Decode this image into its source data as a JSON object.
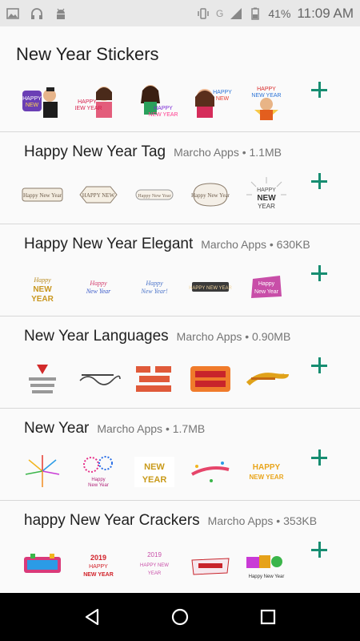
{
  "status_bar": {
    "icons": [
      "image-icon",
      "headphones-icon",
      "android-icon"
    ],
    "right_icons": [
      "vibrate-icon",
      "signal-icon",
      "battery-icon"
    ],
    "network": "G",
    "battery_percent": "41%",
    "time": "11:09 AM"
  },
  "page": {
    "title": "New Year Stickers"
  },
  "colors": {
    "accent": "#168d71",
    "divider": "#d8d8d8",
    "meta": "#757575"
  },
  "packs": [
    {
      "name": "",
      "meta": "",
      "stickers": [
        "couple-man-sticker",
        "woman-new-year-sticker",
        "woman-new-year-sticker-2",
        "woman-new-year-sticker-3",
        "man-happy-new-year-sticker"
      ]
    },
    {
      "name": "Happy New Year Tag",
      "meta": "Marcho Apps • 1.1MB",
      "stickers": [
        "tag-sticker-1",
        "tag-sticker-2",
        "tag-sticker-3",
        "tag-sticker-4",
        "new-year-burst-sticker"
      ]
    },
    {
      "name": "Happy New Year Elegant",
      "meta": "Marcho Apps • 630KB",
      "stickers": [
        "elegant-sticker-1",
        "elegant-sticker-2",
        "elegant-sticker-3",
        "elegant-sticker-4",
        "elegant-sticker-5"
      ]
    },
    {
      "name": "New Year Languages",
      "meta": "Marcho Apps • 0.90MB",
      "stickers": [
        "language-sticker-1",
        "language-sticker-2",
        "language-sticker-3",
        "language-sticker-4",
        "language-sticker-5"
      ]
    },
    {
      "name": "New Year",
      "meta": "Marcho Apps • 1.7MB",
      "stickers": [
        "fireworks-sticker-1",
        "fireworks-sticker-2",
        "gold-new-year-sticker",
        "confetti-sticker",
        "happy-new-year-sticker"
      ]
    },
    {
      "name": "happy New Year Crackers",
      "meta": "Marcho Apps • 353KB",
      "stickers": [
        "crackers-sticker-1",
        "crackers-sticker-2",
        "crackers-sticker-3",
        "crackers-sticker-4",
        "crackers-sticker-5"
      ]
    }
  ],
  "nav": {
    "buttons": [
      "back-icon",
      "home-icon",
      "recents-icon"
    ]
  }
}
